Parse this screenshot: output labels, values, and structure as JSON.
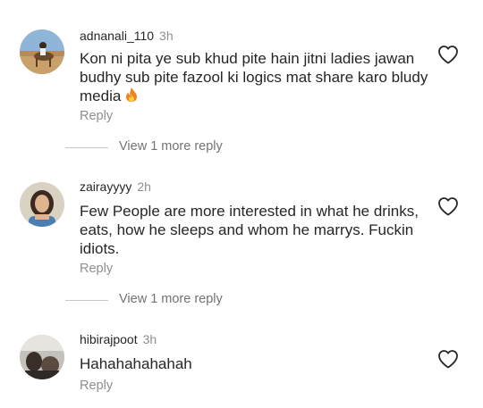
{
  "comments": [
    {
      "username": "adnanali_110",
      "time": "3h",
      "text": "Kon ni pita ye sub khud pite hain jitni ladies jawan budhy sub pite fazool ki logics mat share karo bludy media",
      "emoji": "fire-emoji",
      "reply_label": "Reply",
      "view_more": "View 1 more reply"
    },
    {
      "username": "zairayyyy",
      "time": "2h",
      "text": "Few People are more interested in what he drinks, eats, how he sleeps and whom he marrys. Fuckin idiots.",
      "reply_label": "Reply",
      "view_more": "View 1 more reply"
    },
    {
      "username": "hibirajpoot",
      "time": "3h",
      "text": "Hahahahahahah",
      "reply_label": "Reply"
    }
  ],
  "icons": {
    "like": "heart-outline-icon",
    "emoji": "fire-icon"
  },
  "colors": {
    "text": "#262626",
    "secondary": "#8e8e8e",
    "divider": "#c7c7c7"
  }
}
